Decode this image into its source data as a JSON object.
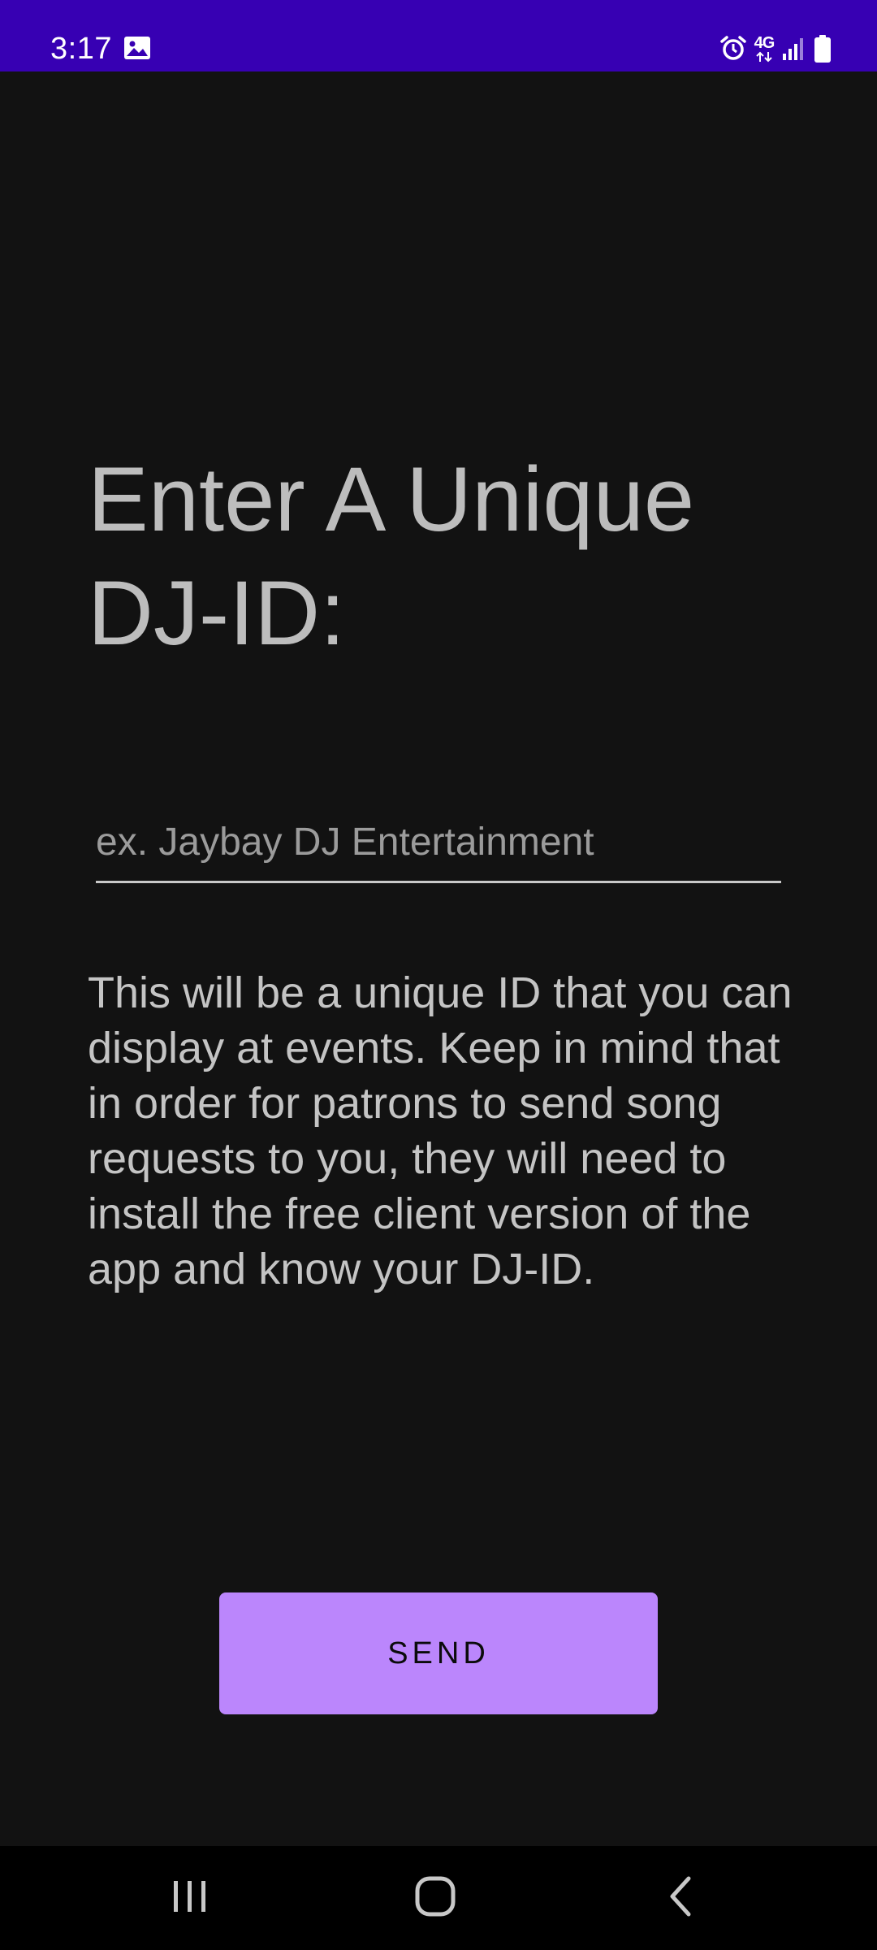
{
  "status_bar": {
    "time": "3:17",
    "network": "4G",
    "background": "#3700b3",
    "icons": [
      "gallery-icon",
      "alarm-icon",
      "network-4g-icon",
      "signal-icon",
      "battery-icon"
    ]
  },
  "main": {
    "heading": "Enter A Unique DJ-ID:",
    "input": {
      "placeholder": "ex. Jaybay DJ Entertainment",
      "value": ""
    },
    "info": "This will be a unique ID that you can display at events. Keep in mind that in order for patrons to send song requests to you, they will need to install the free client version of the app and know your DJ-ID.",
    "send_label": "SEND"
  },
  "nav_bar": {
    "icons": [
      "recent-apps-icon",
      "home-icon",
      "back-icon"
    ]
  },
  "colors": {
    "background": "#121212",
    "accent": "#bb86fc",
    "text": "#bdbdbd"
  }
}
